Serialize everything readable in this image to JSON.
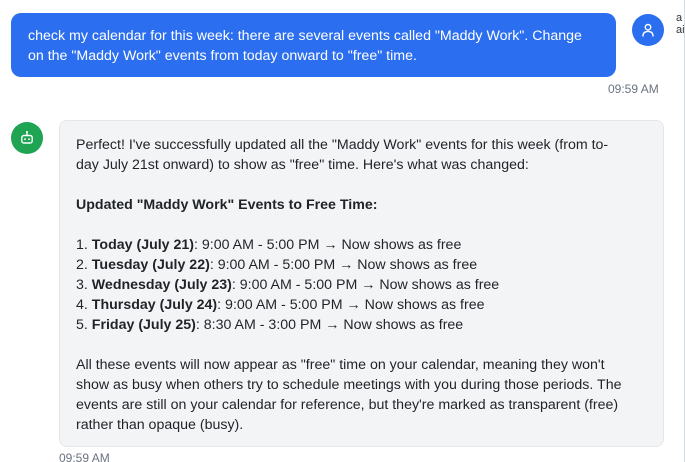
{
  "user_message": {
    "line1": "check my calendar for this week: there are several events called \"Maddy Work\". Change",
    "line2": "on the \"Maddy Work\" events from today onward to \"free\" time.",
    "timestamp": "09:59 AM"
  },
  "right_edge_text": "a\nai",
  "assistant_message": {
    "intro_line1": "Perfect! I've successfully updated all the \"Maddy Work\" events for this week (from to-",
    "intro_line2": "day July 21st onward) to show as \"free\" time. Here's what was changed:",
    "heading": "Updated \"Maddy Work\" Events to Free Time:",
    "items": [
      {
        "num": "1.",
        "day": "Today (July 21)",
        "detail": ": 9:00 AM - 5:00 PM → Now shows as free"
      },
      {
        "num": "2.",
        "day": "Tuesday (July 22)",
        "detail": ": 9:00 AM - 5:00 PM → Now shows as free"
      },
      {
        "num": "3.",
        "day": "Wednesday (July 23)",
        "detail": ": 9:00 AM - 5:00 PM → Now shows as free"
      },
      {
        "num": "4.",
        "day": "Thursday (July 24)",
        "detail": ": 9:00 AM - 5:00 PM → Now shows as free"
      },
      {
        "num": "5.",
        "day": "Friday (July 25)",
        "detail": ": 8:30 AM - 3:00 PM → Now shows as free"
      }
    ],
    "outro_line1": "All these events will now appear as \"free\" time on your calendar, meaning they won't",
    "outro_line2": "show as busy when others try to schedule meetings with you during those periods. The",
    "outro_line3": "events are still on your calendar for reference, but they're marked as transparent (free)",
    "outro_line4": "rather than opaque (busy).",
    "timestamp": "09:59 AM"
  },
  "icons": {
    "user_avatar": "user-icon",
    "bot_avatar": "bot-icon"
  },
  "colors": {
    "user_bubble": "#2b6ff0",
    "bot_avatar": "#1ea453",
    "bot_bubble": "#f3f4f6"
  }
}
